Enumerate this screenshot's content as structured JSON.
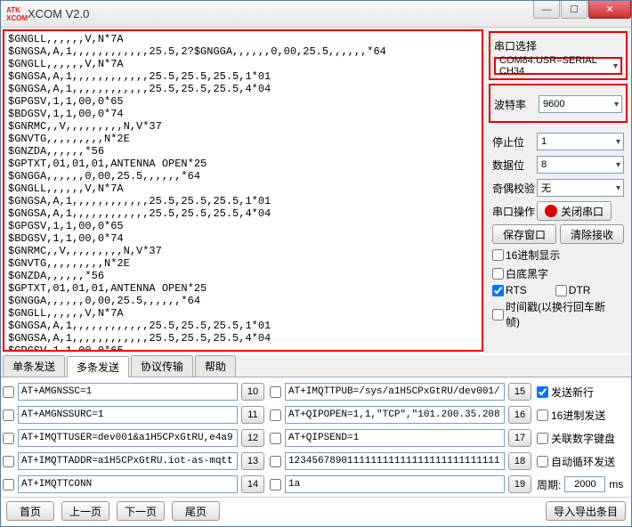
{
  "title": "XCOM V2.0",
  "icon_text": "ATK\nXCOM",
  "terminal_text": "$GNGLL,,,,,,V,N*7A\n$GNGSA,A,1,,,,,,,,,,,,25.5,2?$GNGGA,,,,,,0,00,25.5,,,,,,*64\n$GNGLL,,,,,,V,N*7A\n$GNGSA,A,1,,,,,,,,,,,,25.5,25.5,25.5,1*01\n$GNGSA,A,1,,,,,,,,,,,,25.5,25.5,25.5,4*04\n$GPGSV,1,1,00,0*65\n$BDGSV,1,1,00,0*74\n$GNRMC,,V,,,,,,,,,N,V*37\n$GNVTG,,,,,,,,,N*2E\n$GNZDA,,,,,,*56\n$GPTXT,01,01,01,ANTENNA OPEN*25\n$GNGGA,,,,,,0,00,25.5,,,,,,*64\n$GNGLL,,,,,,V,N*7A\n$GNGSA,A,1,,,,,,,,,,,,25.5,25.5,25.5,1*01\n$GNGSA,A,1,,,,,,,,,,,,25.5,25.5,25.5,4*04\n$GPGSV,1,1,00,0*65\n$BDGSV,1,1,00,0*74\n$GNRMC,,V,,,,,,,,,N,V*37\n$GNVTG,,,,,,,,,N*2E\n$GNZDA,,,,,,*56\n$GPTXT,01,01,01,ANTENNA OPEN*25\n$GNGGA,,,,,,0,00,25.5,,,,,,*64\n$GNGLL,,,,,,V,N*7A\n$GNGSA,A,1,,,,,,,,,,,,25.5,25.5,25.5,1*01\n$GNGSA,A,1,,,,,,,,,,,,25.5,25.5,25.5,4*04\n$GPGSV,1,1,00,0*65",
  "side": {
    "port_group": "串口选择",
    "port_value": "COM84:USR=SERIAL CH34",
    "baud_label": "波特率",
    "baud_value": "9600",
    "stop_label": "停止位",
    "stop_value": "1",
    "data_label": "数据位",
    "data_value": "8",
    "parity_label": "奇偶校验",
    "parity_value": "无",
    "op_label": "串口操作",
    "op_btn": "关闭串口",
    "save_btn": "保存窗口",
    "clear_btn": "清除接收",
    "hex_disp": "16进制显示",
    "white_black": "白底黑字",
    "rts": "RTS",
    "dtr": "DTR",
    "timestamp": "时间戳(以换行回车断帧)"
  },
  "tabs": [
    "单条发送",
    "多条发送",
    "协议传输",
    "帮助"
  ],
  "send": {
    "leftcol": [
      {
        "v": "AT+AMGNSSC=1",
        "n": "10"
      },
      {
        "v": "AT+AMGNSSURC=1",
        "n": "11"
      },
      {
        "v": "AT+IMQTTUSER=dev001&a1H5CPxGtRU,e4a9",
        "n": "12"
      },
      {
        "v": "AT+IMQTTADDR=a1H5CPxGtRU.iot-as-mqtt",
        "n": "13"
      },
      {
        "v": "AT+IMQTTCONN",
        "n": "14"
      }
    ],
    "rightcol": [
      {
        "v": "AT+IMQTTPUB=/sys/a1H5CPxGtRU/dev001/",
        "n": "15"
      },
      {
        "v": "AT+QIPOPEN=1,1,\"TCP\",\"101.200.35.208",
        "n": "16"
      },
      {
        "v": "AT+QIPSEND=1",
        "n": "17"
      },
      {
        "v": "123456789011111111111111111111111111",
        "n": "18"
      },
      {
        "v": "1a",
        "n": "19"
      }
    ],
    "opts": {
      "newline": "发送新行",
      "hex": "16进制发送",
      "numpad": "关联数字键盘",
      "autoloop": "自动循环发送",
      "period_label": "周期:",
      "period_value": "2000",
      "period_unit": "ms"
    }
  },
  "bottom": {
    "first": "首页",
    "prev": "上一页",
    "next": "下一页",
    "last": "尾页",
    "import": "导入导出条目"
  }
}
